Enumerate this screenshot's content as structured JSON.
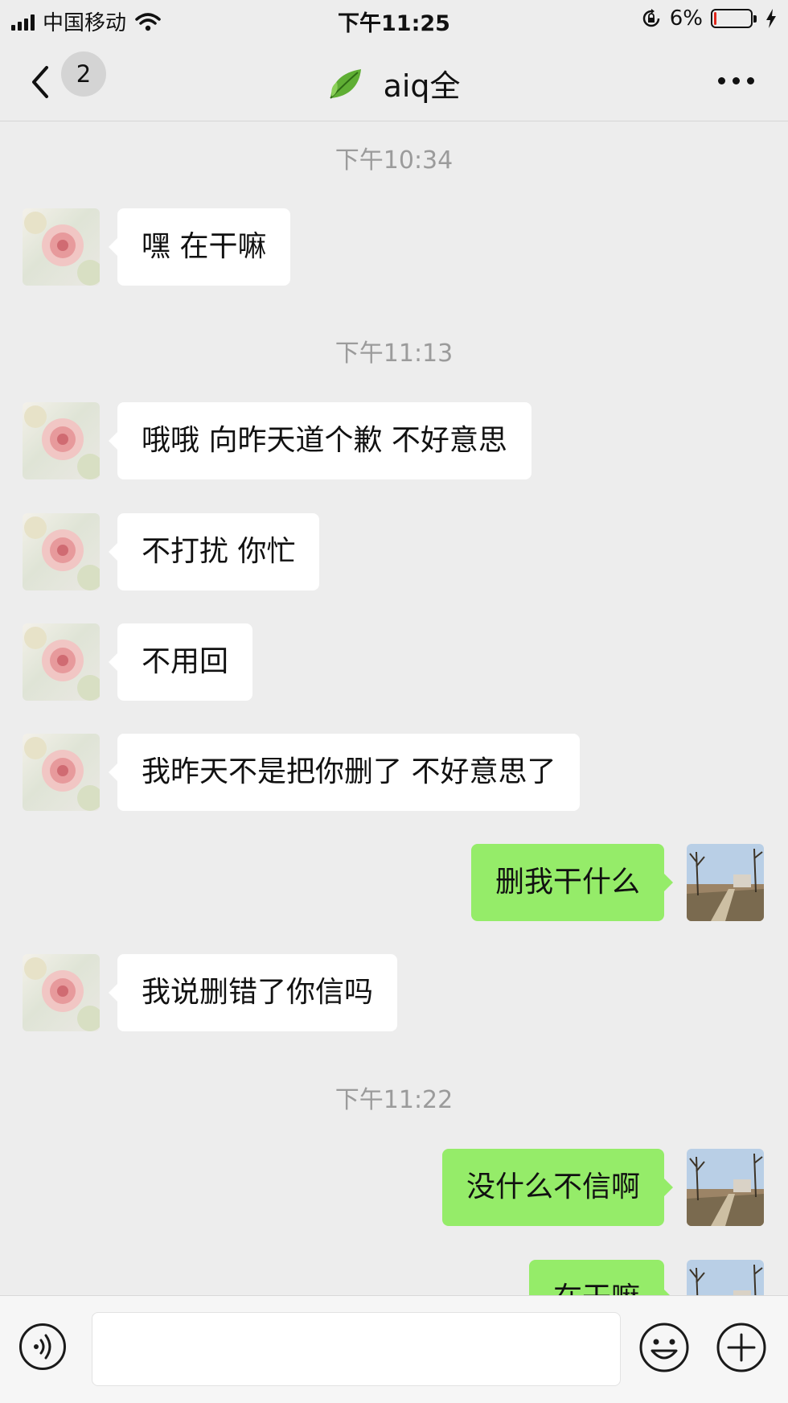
{
  "status_bar": {
    "carrier": "中国移动",
    "time": "下午11:25",
    "battery_text": "6%",
    "battery_level": 0.06
  },
  "nav": {
    "back_badge": "2",
    "title": "aiq全",
    "icons": [
      "back-chevron-icon",
      "leaf-icon",
      "more-icon"
    ]
  },
  "chat": {
    "timestamps": [
      "下午10:34",
      "下午11:13",
      "下午11:22"
    ],
    "messages": [
      {
        "side": "left",
        "text": "嘿  在干嘛"
      },
      {
        "side": "left",
        "text": "哦哦 向昨天道个歉  不好意思"
      },
      {
        "side": "left",
        "text": "不打扰 你忙"
      },
      {
        "side": "left",
        "text": "不用回"
      },
      {
        "side": "left",
        "text": "我昨天不是把你删了  不好意思了"
      },
      {
        "side": "right",
        "text": "删我干什么"
      },
      {
        "side": "left",
        "text": "我说删错了你信吗"
      },
      {
        "side": "right",
        "text": "没什么不信啊"
      },
      {
        "side": "right",
        "text": "在干嘛"
      }
    ]
  },
  "input_bar": {
    "placeholder": "",
    "icons": [
      "voice-icon",
      "emoji-icon",
      "plus-icon"
    ]
  },
  "colors": {
    "background": "#ededed",
    "incoming_bubble": "#ffffff",
    "outgoing_bubble": "#95ec69",
    "timestamp_text": "#9b9b9b"
  }
}
